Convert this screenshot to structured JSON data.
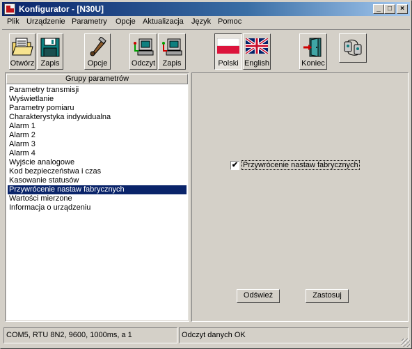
{
  "window": {
    "title": "Konfigurator - [N30U]",
    "min_glyph": "_",
    "max_glyph": "□",
    "close_glyph": "×"
  },
  "menu": [
    "Plik",
    "Urządzenie",
    "Parametry",
    "Opcje",
    "Aktualizacja",
    "Język",
    "Pomoc"
  ],
  "toolbar": {
    "open": "Otwórz",
    "save": "Zapis",
    "options": "Opcje",
    "read": "Odczyt",
    "write": "Zapis",
    "polish": "Polski",
    "english": "English",
    "exit": "Koniec"
  },
  "groups": {
    "header": "Grupy parametrów",
    "items": [
      "Parametry transmisji",
      "Wyświetlanie",
      "Parametry pomiaru",
      "Charakterystyka indywidualna",
      "Alarm 1",
      "Alarm 2",
      "Alarm 3",
      "Alarm 4",
      "Wyjście analogowe",
      "Kod bezpieczeństwa i czas",
      "Kasowanie statusów",
      "Przywrócenie nastaw fabrycznych",
      "Wartości mierzone",
      "Informacja o urządzeniu"
    ],
    "selected_index": 11
  },
  "panel": {
    "checkbox_label": "Przywrócenie nastaw fabrycznych",
    "checkbox_checked": "✔",
    "refresh": "Odśwież",
    "apply": "Zastosuj"
  },
  "status": {
    "connection": "COM5, RTU 8N2, 9600, 1000ms, a 1",
    "message": "Odczyt danych OK"
  },
  "colors": {
    "selection": "#0a246a",
    "face": "#d4d0c8",
    "brand_red": "#c0151b"
  }
}
